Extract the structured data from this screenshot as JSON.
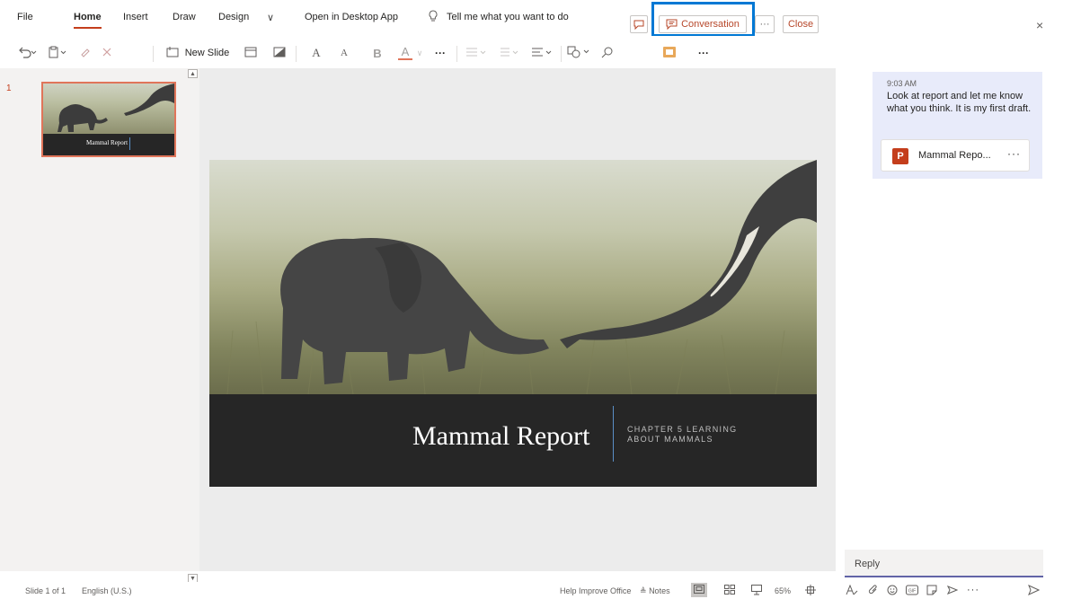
{
  "menu": {
    "file": "File",
    "home": "Home",
    "insert": "Insert",
    "draw": "Draw",
    "design": "Design",
    "more_chevron": "∨",
    "open_desktop": "Open in Desktop App",
    "tell_me": "Tell me what you want to do",
    "conversation": "Conversation",
    "more": "···",
    "close": "Close"
  },
  "ribbon": {
    "new_slide": "New Slide",
    "font_grow": "A",
    "font_shrink": "A",
    "bold": "B",
    "font_color": "A",
    "more": "···",
    "overflow": "···"
  },
  "thumbnails": {
    "slide_number": "1",
    "title": "Mammal Report"
  },
  "slide": {
    "title": "Mammal Report",
    "subtitle": "CHAPTER 5 LEARNING\nABOUT MAMMALS"
  },
  "status": {
    "slide_info": "Slide 1 of 1",
    "language": "English (U.S.)",
    "help_improve": "Help Improve Office",
    "notes": "Notes",
    "zoom": "65%"
  },
  "chat": {
    "close": "×",
    "message_time": "9:03 AM",
    "message_text": "Look at report and let me know what you think.  It is my first draft.",
    "file_name": "Mammal Repo...",
    "file_more": "···",
    "reply_placeholder": "Reply",
    "toolbar_more": "···"
  },
  "colors": {
    "accent": "#c43e1c",
    "highlight_frame": "#0078d4",
    "chat_bubble": "#e8ebfa",
    "slide_band": "#262626"
  }
}
